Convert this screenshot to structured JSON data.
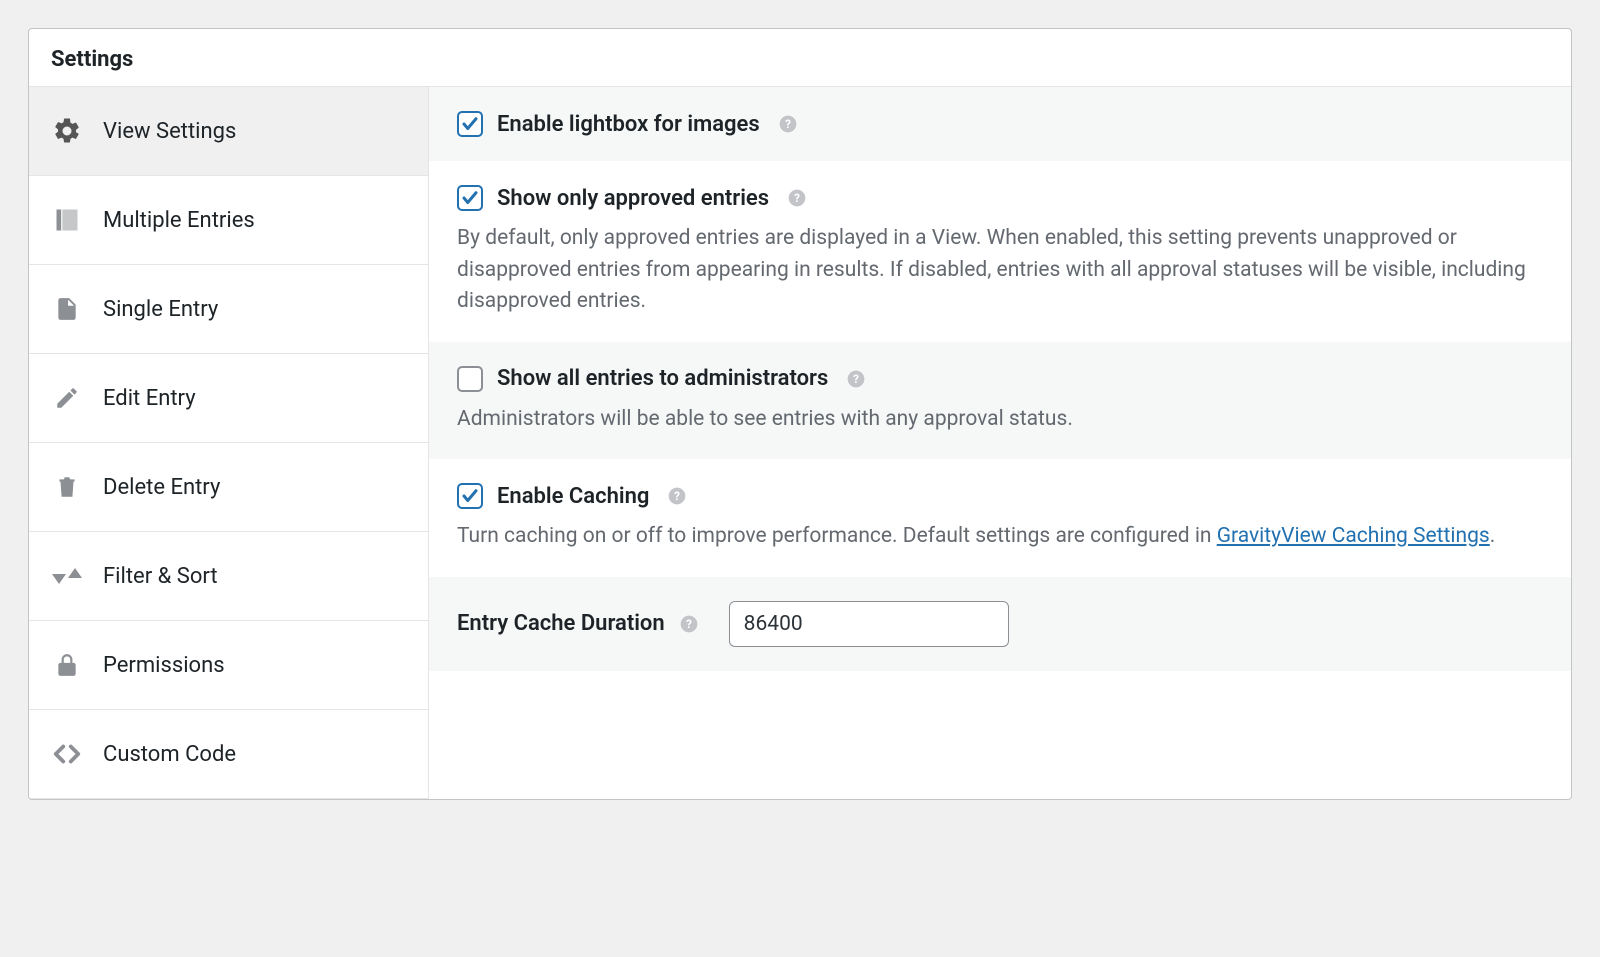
{
  "panel": {
    "title": "Settings"
  },
  "sidebar": {
    "tabs": [
      {
        "id": "view-settings",
        "label": "View Settings",
        "icon": "gear",
        "active": true
      },
      {
        "id": "multiple-entries",
        "label": "Multiple Entries",
        "icon": "stack",
        "active": false
      },
      {
        "id": "single-entry",
        "label": "Single Entry",
        "icon": "page",
        "active": false
      },
      {
        "id": "edit-entry",
        "label": "Edit Entry",
        "icon": "pencil",
        "active": false
      },
      {
        "id": "delete-entry",
        "label": "Delete Entry",
        "icon": "trash",
        "active": false
      },
      {
        "id": "filter-sort",
        "label": "Filter & Sort",
        "icon": "sort",
        "active": false
      },
      {
        "id": "permissions",
        "label": "Permissions",
        "icon": "lock",
        "active": false
      },
      {
        "id": "custom-code",
        "label": "Custom Code",
        "icon": "code",
        "active": false
      }
    ]
  },
  "settings": {
    "lightbox": {
      "label": "Enable lightbox for images",
      "checked": true
    },
    "approved": {
      "label": "Show only approved entries",
      "checked": true,
      "description": "By default, only approved entries are displayed in a View. When enabled, this setting prevents unapproved or disapproved entries from appearing in results. If disabled, entries with all approval statuses will be visible, including disapproved entries."
    },
    "admin_all": {
      "label": "Show all entries to administrators",
      "checked": false,
      "description": "Administrators will be able to see entries with any approval status."
    },
    "caching": {
      "label": "Enable Caching",
      "checked": true,
      "description_prefix": "Turn caching on or off to improve performance. Default settings are configured in ",
      "link_text": "GravityView Caching Settings",
      "description_suffix": "."
    },
    "cache_duration": {
      "label": "Entry Cache Duration",
      "value": "86400"
    }
  }
}
